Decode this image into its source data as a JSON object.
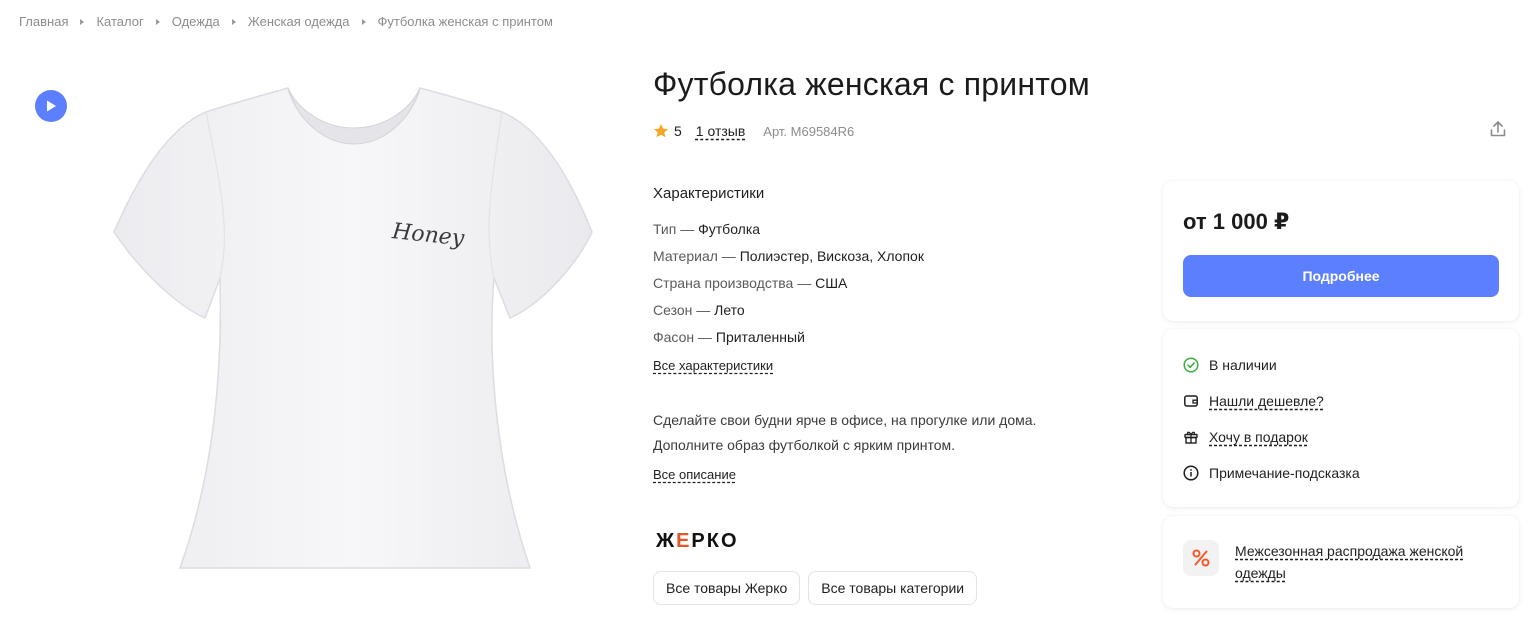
{
  "breadcrumb": [
    "Главная",
    "Каталог",
    "Одежда",
    "Женская одежда",
    "Футболка женская с принтом"
  ],
  "product": {
    "title": "Футболка женская с принтом",
    "rating": "5",
    "reviews_link": "1 отзыв",
    "sku": "Арт. M69584R6",
    "print_text": "Honey"
  },
  "specs": {
    "title": "Характеристики",
    "items": [
      {
        "key": "Тип",
        "value": "Футболка"
      },
      {
        "key": "Материал",
        "value": "Полиэстер, Вискоза, Хлопок"
      },
      {
        "key": "Страна производства",
        "value": "США"
      },
      {
        "key": "Сезон",
        "value": "Лето"
      },
      {
        "key": "Фасон",
        "value": "Приталенный"
      }
    ],
    "all_link": "Все характеристики"
  },
  "description": {
    "line1": "Сделайте свои будни ярче в офисе, на прогулке или дома.",
    "line2": "Дополните образ футболкой с ярким принтом.",
    "all_link": "Все описание"
  },
  "brand": {
    "logo_prefix": "Ж",
    "logo_accent": "Е",
    "logo_suffix": "РКО"
  },
  "tags": [
    "Все товары Жерко",
    "Все товары категории"
  ],
  "price_card": {
    "price": "от 1 000 ₽",
    "button": "Подробнее"
  },
  "info_card": {
    "in_stock": "В наличии",
    "found_cheaper": "Нашли дешевле?",
    "gift": "Хочу в подарок",
    "note": "Примечание-подсказка"
  },
  "promo": {
    "text": "Межсезонная распродажа женской одежды"
  },
  "colors": {
    "accent": "#5b7fff",
    "success": "#3cb043",
    "promo": "#f25a2b",
    "star": "#f5a623"
  },
  "icons": [
    "play-icon",
    "star-icon",
    "share-icon",
    "check-circle-icon",
    "wallet-icon",
    "gift-icon",
    "info-icon",
    "percent-icon"
  ]
}
